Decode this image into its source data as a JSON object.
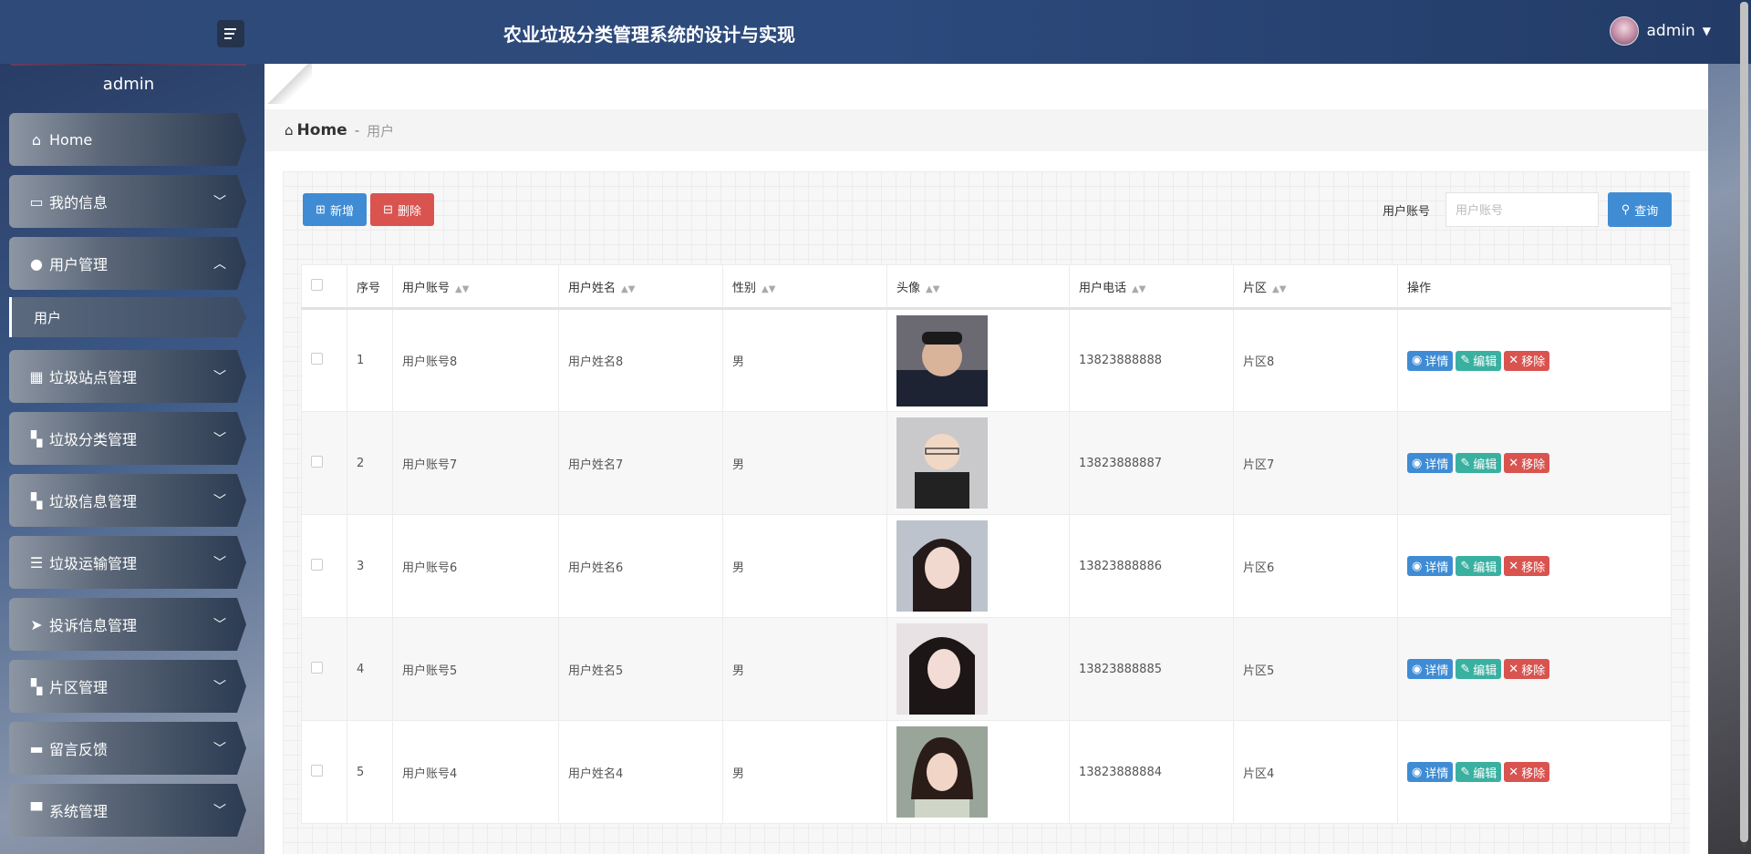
{
  "header": {
    "title": "农业垃圾分类管理系统的设计与实现",
    "user_name": "admin"
  },
  "sidebar": {
    "user_name": "admin",
    "items": [
      {
        "label": "Home",
        "icon": "home-icon"
      },
      {
        "label": "我的信息",
        "icon": "card-icon"
      },
      {
        "label": "用户管理",
        "icon": "bulb-icon",
        "expanded": true,
        "children": [
          {
            "label": "用户"
          }
        ]
      },
      {
        "label": "垃圾站点管理",
        "icon": "grid-icon"
      },
      {
        "label": "垃圾分类管理",
        "icon": "dashboard-icon"
      },
      {
        "label": "垃圾信息管理",
        "icon": "dashboard-icon"
      },
      {
        "label": "垃圾运输管理",
        "icon": "sliders-icon"
      },
      {
        "label": "投诉信息管理",
        "icon": "send-icon"
      },
      {
        "label": "片区管理",
        "icon": "dashboard-icon"
      },
      {
        "label": "留言反馈",
        "icon": "inbox-icon"
      },
      {
        "label": "系统管理",
        "icon": "desktop-icon"
      }
    ]
  },
  "breadcrumb": {
    "home": "Home",
    "sep": "-",
    "current": "用户"
  },
  "toolbar": {
    "add_label": "新增",
    "delete_label": "删除",
    "search_label": "用户账号",
    "search_placeholder": "用户账号",
    "search_button": "查询"
  },
  "table": {
    "headers": [
      "序号",
      "用户账号",
      "用户姓名",
      "性别",
      "头像",
      "用户电话",
      "片区",
      "操作"
    ],
    "actions": {
      "view": "详情",
      "edit": "编辑",
      "remove": "移除"
    },
    "rows": [
      {
        "no": "1",
        "account": "用户账号8",
        "name": "用户姓名8",
        "gender": "男",
        "phone": "13823888888",
        "area": "片区8"
      },
      {
        "no": "2",
        "account": "用户账号7",
        "name": "用户姓名7",
        "gender": "男",
        "phone": "13823888887",
        "area": "片区7"
      },
      {
        "no": "3",
        "account": "用户账号6",
        "name": "用户姓名6",
        "gender": "男",
        "phone": "13823888886",
        "area": "片区6"
      },
      {
        "no": "4",
        "account": "用户账号5",
        "name": "用户姓名5",
        "gender": "男",
        "phone": "13823888885",
        "area": "片区5"
      },
      {
        "no": "5",
        "account": "用户账号4",
        "name": "用户姓名4",
        "gender": "男",
        "phone": "13823888884",
        "area": "片区4"
      }
    ]
  },
  "colors": {
    "primary": "#3f8cd4",
    "danger": "#d9534f",
    "success": "#3ab0a0"
  }
}
